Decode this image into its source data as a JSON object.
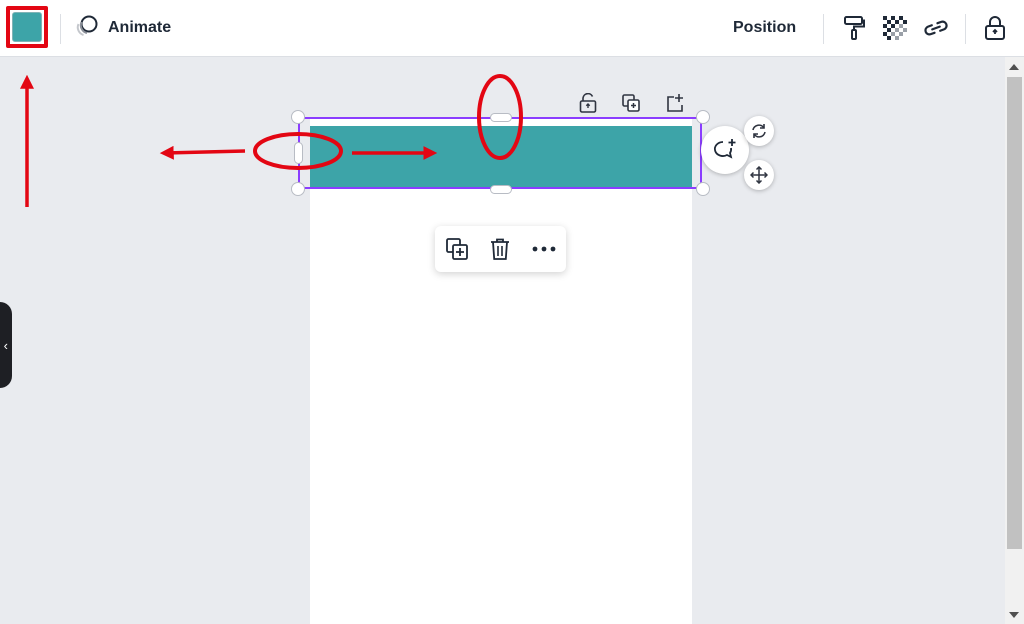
{
  "toolbar": {
    "color_swatch": "#3da4a8",
    "animate_label": "Animate",
    "position_label": "Position",
    "icons": [
      "paint-roller-icon",
      "transparency-icon",
      "link-icon",
      "lock-icon"
    ]
  },
  "selection": {
    "above_icons": [
      "unlock-icon",
      "duplicate-icon",
      "add-page-icon"
    ],
    "side_buttons": [
      "rotate-icon",
      "move-icon"
    ],
    "comment_button": "add-comment-icon"
  },
  "context_menu": {
    "items": [
      "duplicate-icon",
      "trash-icon",
      "more-icon"
    ]
  },
  "side_panel": {
    "toggle_glyph": "‹"
  },
  "colors": {
    "shape_fill": "#3da4a8",
    "selection": "#8b3dff",
    "annotation": "#e30613"
  }
}
